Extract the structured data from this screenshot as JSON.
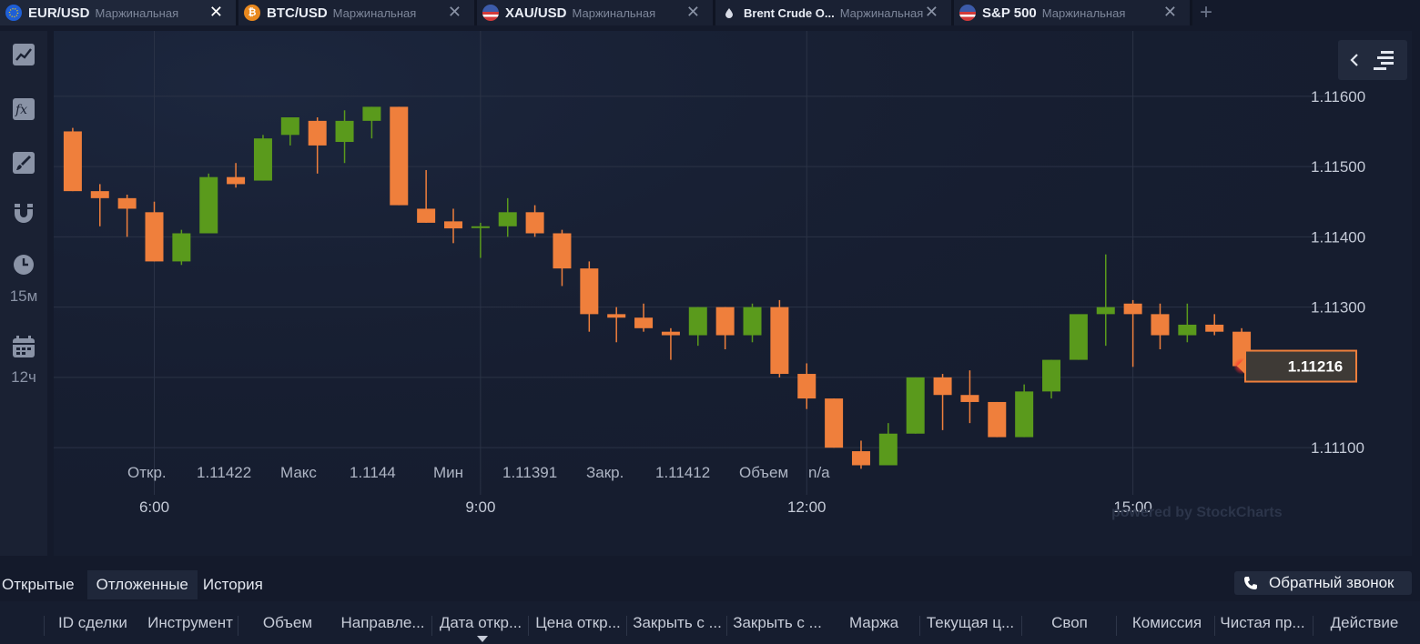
{
  "tabs": [
    {
      "symbol": "EUR/USD",
      "kind": "Маржинальная",
      "active": true,
      "flag_color": "#1f5fd6"
    },
    {
      "symbol": "BTC/USD",
      "kind": "Маржинальная",
      "active": false,
      "flag_color": "#e8881e"
    },
    {
      "symbol": "XAU/USD",
      "kind": "Маржинальная",
      "active": false,
      "flag_color": "#3c5ba9"
    },
    {
      "symbol": "Brent Crude O...",
      "kind": "Маржинальная",
      "active": false,
      "flag_color": "#1a2133"
    },
    {
      "symbol": "S&P 500",
      "kind": "Маржинальная",
      "active": false,
      "flag_color": "#3c5ba9"
    }
  ],
  "tab_close_glyph": "✕",
  "tab_add_glyph": "+",
  "left_toolbar": {
    "timeframe_label": "15м",
    "period_label": "12ч"
  },
  "chart_data": {
    "type": "candlestick",
    "y_ticks": [
      "1.11600",
      "1.11500",
      "1.11400",
      "1.11300",
      "1.11100"
    ],
    "y_tick_values": [
      1.116,
      1.115,
      1.114,
      1.113,
      1.111
    ],
    "ylim": [
      1.1102,
      1.1168
    ],
    "x_ticks": [
      "6:00",
      "9:00",
      "12:00",
      "15:00"
    ],
    "x_tick_values": [
      3,
      15,
      27,
      39
    ],
    "xlim": [
      -0.7,
      43.5
    ],
    "current_price": "1.11216",
    "current_price_value": 1.11216,
    "ohlc_labels": {
      "open_label": "Откр.",
      "open_value": "1.11422",
      "high_label": "Макс",
      "high_value": "1.1144",
      "low_label": "Мин",
      "low_value": "1.11391",
      "close_label": "Закр.",
      "close_value": "1.11412",
      "volume_label": "Объем",
      "volume_value": "n/a"
    },
    "watermark": "powered by StockCharts",
    "colors": {
      "up": "#5a9a1c",
      "down": "#ef7f3c",
      "grid": "#2b3346"
    },
    "candles": [
      [
        1.1155,
        1.11555,
        1.11465,
        1.11465
      ],
      [
        1.11465,
        1.11475,
        1.11415,
        1.11455
      ],
      [
        1.11455,
        1.1146,
        1.114,
        1.1144
      ],
      [
        1.11435,
        1.1145,
        1.11365,
        1.11365
      ],
      [
        1.11365,
        1.1141,
        1.1136,
        1.11405
      ],
      [
        1.11405,
        1.1149,
        1.11405,
        1.11485
      ],
      [
        1.11485,
        1.11505,
        1.1147,
        1.11475
      ],
      [
        1.1148,
        1.11545,
        1.1148,
        1.1154
      ],
      [
        1.11545,
        1.1157,
        1.1153,
        1.1157
      ],
      [
        1.11565,
        1.1157,
        1.1149,
        1.1153
      ],
      [
        1.11535,
        1.1158,
        1.11505,
        1.11565
      ],
      [
        1.11565,
        1.11585,
        1.1154,
        1.11585
      ],
      [
        1.11585,
        1.11585,
        1.11445,
        1.11445
      ],
      [
        1.1144,
        1.11495,
        1.1142,
        1.1142
      ],
      [
        1.11422,
        1.1144,
        1.11391,
        1.11412
      ],
      [
        1.11415,
        1.1142,
        1.1137,
        1.11415
      ],
      [
        1.11415,
        1.11455,
        1.114,
        1.11435
      ],
      [
        1.11435,
        1.11445,
        1.114,
        1.11405
      ],
      [
        1.11405,
        1.1141,
        1.1133,
        1.11355
      ],
      [
        1.11355,
        1.11365,
        1.11265,
        1.1129
      ],
      [
        1.1129,
        1.113,
        1.1125,
        1.11285
      ],
      [
        1.11285,
        1.11305,
        1.11265,
        1.1127
      ],
      [
        1.11265,
        1.1127,
        1.11225,
        1.1126
      ],
      [
        1.1126,
        1.113,
        1.11245,
        1.113
      ],
      [
        1.113,
        1.113,
        1.1124,
        1.1126
      ],
      [
        1.1126,
        1.11305,
        1.1125,
        1.113
      ],
      [
        1.113,
        1.1131,
        1.112,
        1.11205
      ],
      [
        1.11205,
        1.1122,
        1.11155,
        1.1117
      ],
      [
        1.1117,
        1.1117,
        1.111,
        1.111
      ],
      [
        1.11095,
        1.1111,
        1.1107,
        1.11075
      ],
      [
        1.11075,
        1.11135,
        1.11075,
        1.1112
      ],
      [
        1.1112,
        1.112,
        1.1112,
        1.112
      ],
      [
        1.112,
        1.11205,
        1.11125,
        1.11175
      ],
      [
        1.11175,
        1.1121,
        1.11135,
        1.11165
      ],
      [
        1.11165,
        1.11165,
        1.11115,
        1.11115
      ],
      [
        1.11115,
        1.1119,
        1.11115,
        1.1118
      ],
      [
        1.1118,
        1.11225,
        1.1117,
        1.11225
      ],
      [
        1.11225,
        1.11265,
        1.11225,
        1.1129
      ],
      [
        1.1129,
        1.11375,
        1.11245,
        1.113
      ],
      [
        1.11305,
        1.1131,
        1.11215,
        1.1129
      ],
      [
        1.1129,
        1.11305,
        1.1124,
        1.1126
      ],
      [
        1.1126,
        1.11305,
        1.1125,
        1.11275
      ],
      [
        1.11275,
        1.1129,
        1.1126,
        1.11265
      ],
      [
        1.11265,
        1.1127,
        1.11216,
        1.11216
      ]
    ]
  },
  "bottom_panel": {
    "tabs": [
      {
        "label": "Открытые",
        "active": false
      },
      {
        "label": "Отложенные",
        "active": true
      },
      {
        "label": "История",
        "active": false
      }
    ],
    "callback_label": "Обратный звонок",
    "columns": [
      "ID сделки",
      "Инструмент",
      "Объем",
      "Направле...",
      "Дата откр...",
      "Цена откр...",
      "Закрыть с ...",
      "Закрыть с ...",
      "Маржа",
      "Текущая ц...",
      "Своп",
      "Комиссия",
      "Чистая пр...",
      "Действие"
    ]
  }
}
